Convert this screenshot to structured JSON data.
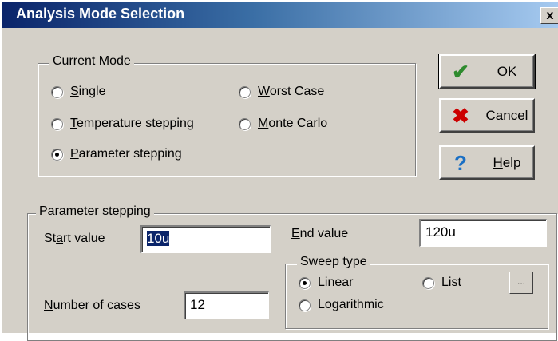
{
  "window": {
    "title": "Analysis Mode Selection",
    "close_glyph": "x"
  },
  "current_mode": {
    "legend": "Current Mode",
    "options": [
      {
        "key": "S",
        "rest": "ingle",
        "selected": false
      },
      {
        "key": "W",
        "rest": "orst Case",
        "selected": false
      },
      {
        "key": "T",
        "rest": "emperature stepping",
        "selected": false
      },
      {
        "key": "M",
        "rest": "onte Carlo",
        "selected": false
      },
      {
        "key": "P",
        "rest": "arameter stepping",
        "selected": true
      }
    ]
  },
  "buttons": {
    "ok": {
      "label": "OK",
      "icon": "checkmark-icon",
      "icon_color": "#2e8b2e"
    },
    "cancel": {
      "label": "Cancel",
      "icon": "x-icon",
      "icon_color": "#cc0000"
    },
    "help": {
      "key": "H",
      "rest": "elp",
      "icon": "question-icon",
      "icon_color": "#1a6fc4"
    }
  },
  "parameter_stepping": {
    "legend": "Parameter stepping",
    "start": {
      "pre": "St",
      "key": "a",
      "post": "rt value",
      "value": "10u"
    },
    "end": {
      "key": "E",
      "rest": "nd value",
      "value": "120u"
    },
    "cases": {
      "key": "N",
      "rest": "umber of cases",
      "value": "12"
    },
    "sweep": {
      "legend": "Sweep type",
      "linear": {
        "key": "L",
        "rest": "inear",
        "selected": true
      },
      "list": {
        "pre": "Lis",
        "key": "t",
        "selected": false
      },
      "logarithmic": {
        "pre": "Lo",
        "key": "g",
        "post": "arithmic",
        "selected": false
      },
      "browse_label": "..."
    }
  }
}
